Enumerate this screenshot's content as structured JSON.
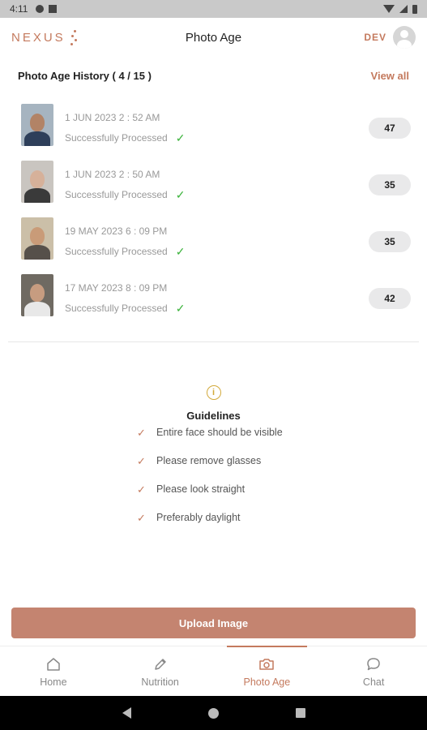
{
  "status_bar": {
    "time": "4:11"
  },
  "header": {
    "logo_text": "NEXUS",
    "title": "Photo Age",
    "env_badge": "DEV"
  },
  "history": {
    "title": "Photo Age History ( 4 / 15 )",
    "view_all": "View all",
    "items": [
      {
        "date": "1 JUN 2023  2 : 52 AM",
        "status": "Successfully Processed",
        "age": "47",
        "bg": "#a6b4c0",
        "skin": "#b28366",
        "shirt": "#2e3f5a"
      },
      {
        "date": "1 JUN 2023  2 : 50 AM",
        "status": "Successfully Processed",
        "age": "35",
        "bg": "#c9c5c0",
        "skin": "#d6b19a",
        "shirt": "#3a3a3a"
      },
      {
        "date": "19 MAY 2023  6 : 09 PM",
        "status": "Successfully Processed",
        "age": "35",
        "bg": "#cbbfa8",
        "skin": "#c99b78",
        "shirt": "#56504a"
      },
      {
        "date": "17 MAY 2023  8 : 09 PM",
        "status": "Successfully Processed",
        "age": "42",
        "bg": "#6f6a62",
        "skin": "#c79c80",
        "shirt": "#e8e8e8"
      }
    ]
  },
  "guidelines": {
    "title": "Guidelines",
    "items": [
      "Entire face should be visible",
      "Please remove glasses",
      "Please look straight",
      "Preferably daylight"
    ]
  },
  "upload_button": "Upload Image",
  "nav": {
    "items": [
      {
        "label": "Home",
        "icon": "home-icon"
      },
      {
        "label": "Nutrition",
        "icon": "pencil-icon"
      },
      {
        "label": "Photo Age",
        "icon": "camera-icon",
        "active": true
      },
      {
        "label": "Chat",
        "icon": "chat-icon"
      }
    ]
  },
  "colors": {
    "accent": "#c47a5e",
    "button": "#c48470",
    "success": "#3bb33b",
    "info": "#d2a93a"
  }
}
